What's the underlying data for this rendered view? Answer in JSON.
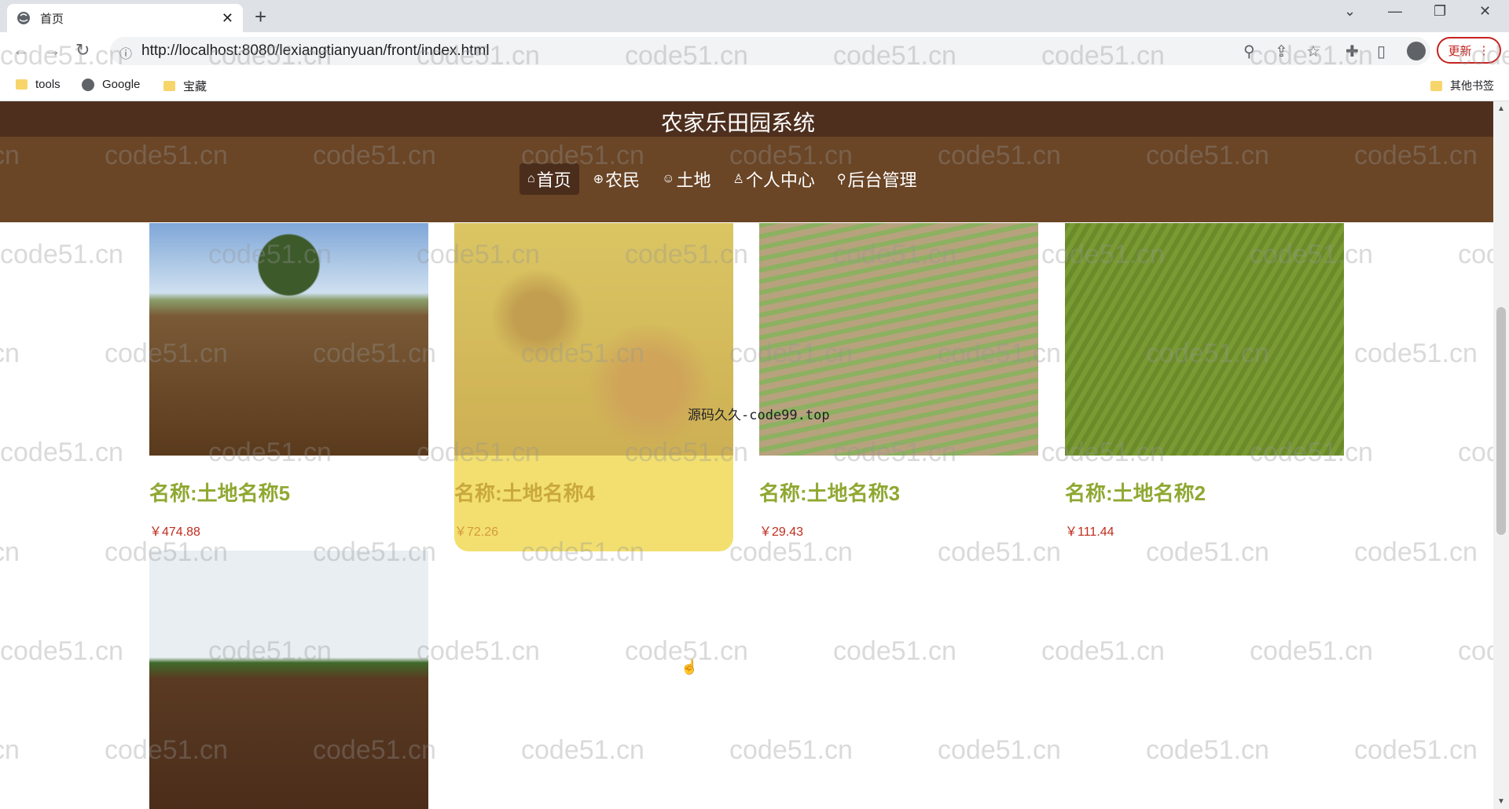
{
  "browser": {
    "tab_title": "首页",
    "tab_close": "✕",
    "new_tab": "+",
    "url": "http://localhost:8080/lexiangtianyuan/front/index.html",
    "update_label": "更新",
    "bookmarks": [
      "tools",
      "Google",
      "宝藏"
    ],
    "other_bookmarks": "其他书签",
    "window_controls": [
      "⌄",
      "—",
      "❐",
      "✕"
    ]
  },
  "site": {
    "title": "农家乐田园系统",
    "nav": [
      {
        "icon": "⌂",
        "label": "首页",
        "active": true
      },
      {
        "icon": "⊕",
        "label": "农民",
        "active": false
      },
      {
        "icon": "☺",
        "label": "土地",
        "active": false
      },
      {
        "icon": "♙",
        "label": "个人中心",
        "active": false
      },
      {
        "icon": "⚲",
        "label": "后台管理",
        "active": false
      }
    ]
  },
  "products": [
    {
      "name": "名称:土地名称5",
      "price": "￥474.88"
    },
    {
      "name": "名称:土地名称4",
      "price": "￥72.26"
    },
    {
      "name": "名称:土地名称3",
      "price": "￥29.43"
    },
    {
      "name": "名称:土地名称2",
      "price": "￥111.44"
    },
    {
      "name": "",
      "price": ""
    }
  ],
  "overlay_text": "源码久久-code99.top",
  "watermark": "code51.cn",
  "colors": {
    "header_dark": "#4e2f1e",
    "header": "#6a4526",
    "product_name": "#8fa832",
    "price": "#c02c1e",
    "hover_card": "#f2df6f"
  }
}
